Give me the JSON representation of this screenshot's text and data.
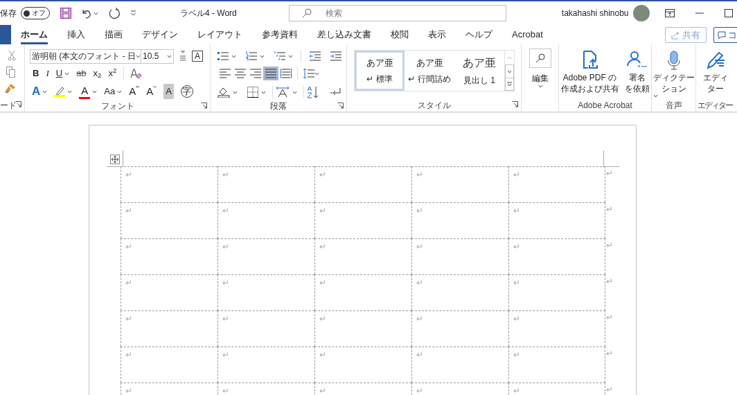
{
  "title_bar": {
    "autosave_label": "保存",
    "autosave_toggle": {
      "label": "オフ",
      "on": false
    },
    "document_title": "ラベル4  -  Word",
    "search": {
      "placeholder": "検索"
    },
    "user_name": "takahashi shinobu"
  },
  "tabs": [
    {
      "label": "ホーム",
      "selected": true
    },
    {
      "label": "挿入",
      "selected": false
    },
    {
      "label": "描画",
      "selected": false
    },
    {
      "label": "デザイン",
      "selected": false
    },
    {
      "label": "レイアウト",
      "selected": false
    },
    {
      "label": "参考資料",
      "selected": false
    },
    {
      "label": "差し込み文書",
      "selected": false
    },
    {
      "label": "校閲",
      "selected": false
    },
    {
      "label": "表示",
      "selected": false
    },
    {
      "label": "ヘルプ",
      "selected": false
    },
    {
      "label": "Acrobat",
      "selected": false
    }
  ],
  "share_button": "共有",
  "comments_button": "コ",
  "ribbon": {
    "clipboard": {
      "label": "ード"
    },
    "font": {
      "label": "フォント",
      "font_name": "游明朝 (本文のフォント - 日",
      "font_size": "10.5",
      "enclose_button": "A",
      "row_2": [
        {
          "kind": "bold",
          "label": "B"
        },
        {
          "kind": "italic",
          "label": "I"
        },
        {
          "kind": "underline",
          "label": "U"
        },
        {
          "kind": "strike",
          "label": "ab"
        },
        {
          "kind": "plain",
          "label": "x$_{2}$"
        },
        {
          "kind": "plain",
          "label": "x$^{2}$"
        }
      ],
      "row_3": [
        {
          "kind": "effects",
          "label": "A"
        },
        {
          "kind": "highlight",
          "color": "#ffff00"
        },
        {
          "kind": "fontcolor",
          "label": "A",
          "color": "#ff0000"
        },
        {
          "kind": "case",
          "label": "Aa"
        },
        {
          "kind": "grow",
          "label": "A"
        },
        {
          "kind": "shrink",
          "label": "A"
        },
        {
          "kind": "shade",
          "label": "A"
        },
        {
          "kind": "circle",
          "label": "字"
        }
      ]
    },
    "paragraph": {
      "label": "段落",
      "alignment": [
        {
          "kind": "left",
          "selected": false
        },
        {
          "kind": "center",
          "selected": false
        },
        {
          "kind": "right",
          "selected": false
        },
        {
          "kind": "justify",
          "selected": true
        },
        {
          "kind": "distributed",
          "selected": false
        }
      ]
    },
    "styles": {
      "label": "スタイル",
      "items": [
        {
          "preview": "あア亜",
          "name": "↵ 標準",
          "kind": "body",
          "selected": true
        },
        {
          "preview": "あア亜",
          "name": "↵ 行間詰め",
          "kind": "body",
          "selected": false
        },
        {
          "preview": "あア亜",
          "name": "見出し 1",
          "kind": "heading",
          "selected": false
        }
      ]
    },
    "editing": {
      "label": "編集"
    },
    "acrobat": {
      "label": "Adobe Acrobat",
      "buttons": [
        {
          "kind": "pdf",
          "lines": [
            "Adobe PDF の",
            "作成および共有"
          ]
        },
        {
          "kind": "sign",
          "lines": [
            "署名",
            "を依頼"
          ]
        }
      ]
    },
    "voice": {
      "label": "音声",
      "lines": [
        "ディクテー",
        "ション"
      ]
    },
    "editor": {
      "label": "エディター",
      "lines": [
        "エディ",
        "ター"
      ]
    }
  },
  "table": {
    "rows": [
      [
        "↵",
        "↵",
        "↵",
        "↵",
        "↵",
        "↵"
      ],
      [
        "↵",
        "↵",
        "↵",
        "↵",
        "↵",
        "↵"
      ],
      [
        "↵",
        "↵",
        "↵",
        "↵",
        "↵",
        "↵"
      ],
      [
        "↵",
        "↵",
        "↵",
        "↵",
        "↵",
        "↵"
      ],
      [
        "↵",
        "↵",
        "↵",
        "↵",
        "↵",
        "↵"
      ],
      [
        "↵",
        "↵",
        "↵",
        "↵",
        "↵",
        "↵"
      ],
      [
        "↵",
        "↵",
        "↵",
        "↵",
        "↵",
        "↵"
      ]
    ]
  }
}
